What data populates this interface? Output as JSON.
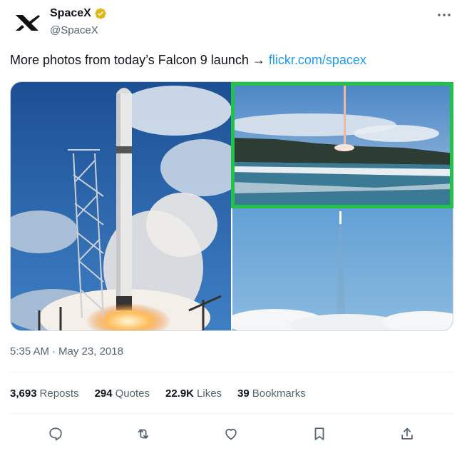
{
  "colors": {
    "accent": "#1d9bf0",
    "verified_gold": "#e2b719",
    "highlight_box": "#22c24a",
    "secondary_text": "#536471"
  },
  "author": {
    "display_name": "SpaceX",
    "handle": "@SpaceX",
    "avatar_icon": "spacex-logo-icon",
    "verified_icon": "verified-badge-icon"
  },
  "tweet": {
    "text": "More photos from today’s Falcon 9 launch → ",
    "link_text": "flickr.com/spacex"
  },
  "media": {
    "photos": [
      {
        "subject": "falcon-9-launch-pad-photo"
      },
      {
        "subject": "rocket-ascending-over-coastline-photo"
      },
      {
        "subject": "rocket-trail-in-blue-sky-photo"
      }
    ]
  },
  "timestamp": {
    "time": "5:35 AM",
    "separator": "·",
    "date": "May 23, 2018"
  },
  "stats": {
    "reposts": {
      "count": "3,693",
      "label": "Reposts"
    },
    "quotes": {
      "count": "294",
      "label": "Quotes"
    },
    "likes": {
      "count": "22.9K",
      "label": "Likes"
    },
    "bookmarks": {
      "count": "39",
      "label": "Bookmarks"
    }
  },
  "actions": [
    "reply-icon",
    "repost-icon",
    "like-icon",
    "bookmark-icon",
    "share-icon"
  ]
}
